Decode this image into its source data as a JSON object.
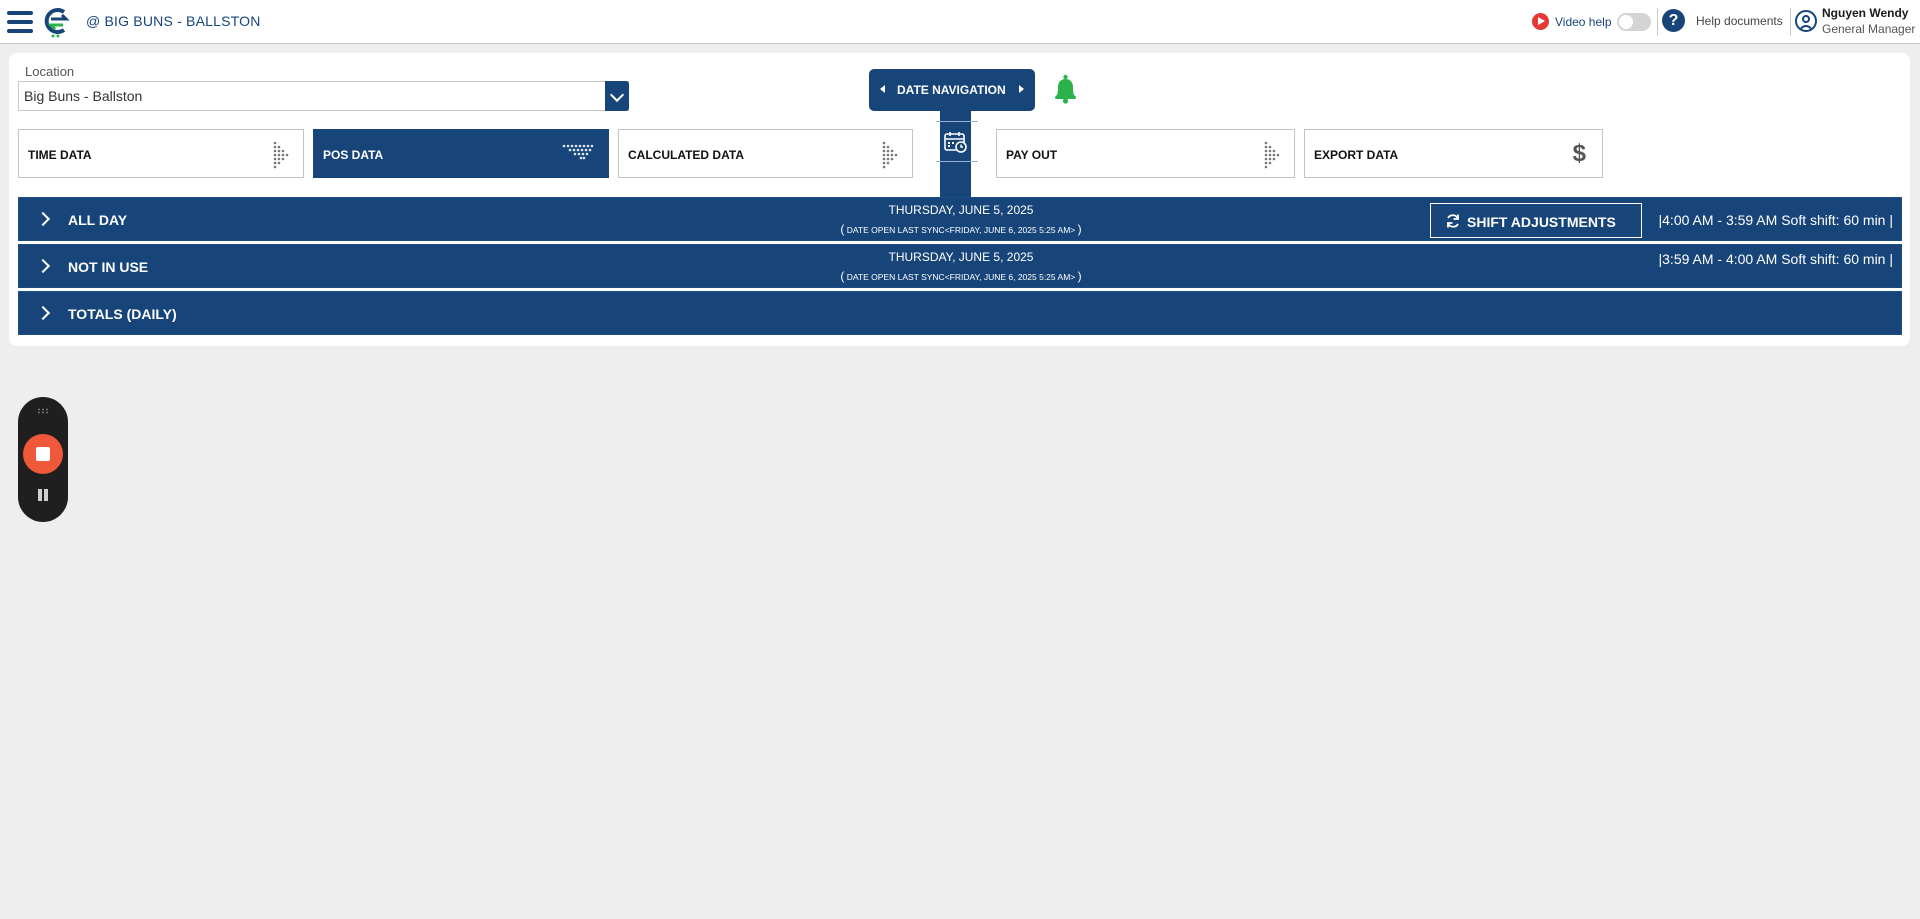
{
  "header": {
    "site_name": "@ BIG BUNS - BALLSTON",
    "video_help_label": "Video help",
    "help_docs_label": "Help documents",
    "user_name": "Nguyen Wendy",
    "user_role": "General Manager"
  },
  "location": {
    "label": "Location",
    "selected": "Big Buns - Ballston"
  },
  "date_navigation": {
    "label": "DATE NAVIGATION"
  },
  "sections": [
    {
      "label": "TIME DATA",
      "active": false
    },
    {
      "label": "POS DATA",
      "active": true
    },
    {
      "label": "CALCULATED DATA",
      "active": false
    },
    {
      "label": "PAY OUT",
      "active": false
    },
    {
      "label": "EXPORT DATA",
      "active": false
    }
  ],
  "rows": [
    {
      "title": "ALL DAY",
      "date": "THURSDAY, JUNE 5, 2025",
      "sync_prefix": "(",
      "sync_text": "DATE OPEN LAST SYNC<FRIDAY, JUNE 6, 2025 5:25 AM>",
      "sync_suffix": ")",
      "shift": "|4:00 AM - 3:59 AM Soft shift: 60 min |"
    },
    {
      "title": "NOT IN USE",
      "date": "THURSDAY, JUNE 5, 2025",
      "sync_prefix": "(",
      "sync_text": "DATE OPEN LAST SYNC<FRIDAY, JUNE 6, 2025 5:25 AM>",
      "sync_suffix": ")",
      "shift": "|3:59 AM - 4:00 AM Soft shift: 60 min |"
    },
    {
      "title": "TOTALS (DAILY)"
    }
  ],
  "shift_adjustments_label": "SHIFT ADJUSTMENTS",
  "colors": {
    "primary": "#17457a",
    "bell": "#2bb34a",
    "record": "#f0583a",
    "video_dot": "#e53935"
  }
}
